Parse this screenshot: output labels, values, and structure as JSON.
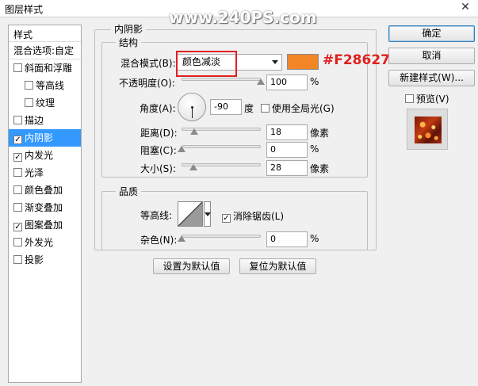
{
  "window": {
    "title": "图层样式",
    "close_glyph": "✕"
  },
  "watermark": "www.240PS.com",
  "styles_list": {
    "header": "样式",
    "blend_options": "混合选项:自定",
    "items": [
      {
        "label": "斜面和浮雕",
        "checked": false
      },
      {
        "label": "等高线",
        "checked": false,
        "sub": true
      },
      {
        "label": "纹理",
        "checked": false,
        "sub": true
      },
      {
        "label": "描边",
        "checked": false
      },
      {
        "label": "内阴影",
        "checked": true,
        "selected": true
      },
      {
        "label": "内发光",
        "checked": true
      },
      {
        "label": "光泽",
        "checked": false
      },
      {
        "label": "颜色叠加",
        "checked": false
      },
      {
        "label": "渐变叠加",
        "checked": false
      },
      {
        "label": "图案叠加",
        "checked": true
      },
      {
        "label": "外发光",
        "checked": false
      },
      {
        "label": "投影",
        "checked": false
      }
    ]
  },
  "panel": {
    "title": "内阴影",
    "structure": {
      "title": "结构",
      "blend_mode_label": "混合模式(B):",
      "blend_mode_value": "颜色减淡",
      "color_hex": "#F28627",
      "opacity_label": "不透明度(O):",
      "opacity_value": "100",
      "opacity_unit": "%",
      "opacity_level": 1.0,
      "angle_label": "角度(A):",
      "angle_value": "-90",
      "angle_unit": "度",
      "global_light_label": "使用全局光(G)",
      "global_light_checked": false,
      "distance_label": "距离(D):",
      "distance_value": "18",
      "distance_unit": "像素",
      "choke_label": "阻塞(C):",
      "choke_value": "0",
      "choke_unit": "%",
      "size_label": "大小(S):",
      "size_value": "28",
      "size_unit": "像素"
    },
    "quality": {
      "title": "品质",
      "contour_label": "等高线:",
      "anti_alias_label": "消除锯齿(L)",
      "anti_alias_checked": true,
      "noise_label": "杂色(N):",
      "noise_value": "0",
      "noise_unit": "%"
    },
    "set_default": "设置为默认值",
    "reset_default": "复位为默认值"
  },
  "buttons": {
    "ok": "确定",
    "cancel": "取消",
    "new_style": "新建样式(W)...",
    "preview_label": "预览(V)",
    "preview_checked": false
  },
  "colors": {
    "swatch": "#F28627",
    "selection": "#3399ff",
    "annotation": "#e02020"
  }
}
